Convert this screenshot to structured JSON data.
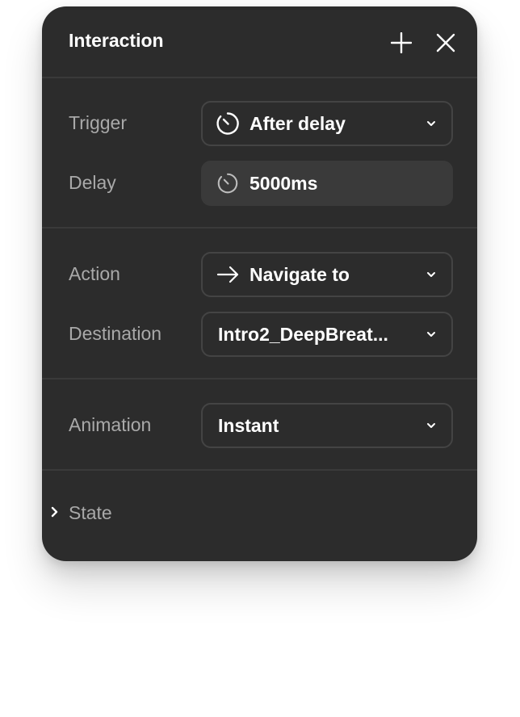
{
  "panel": {
    "title": "Interaction",
    "add_icon": "plus-icon",
    "close_icon": "close-icon"
  },
  "trigger": {
    "label": "Trigger",
    "value": "After delay",
    "icon": "timer-icon"
  },
  "delay": {
    "label": "Delay",
    "value": "5000ms",
    "icon": "timer-icon"
  },
  "action": {
    "label": "Action",
    "value": "Navigate to",
    "icon": "arrow-right-icon"
  },
  "destination": {
    "label": "Destination",
    "value": "Intro2_DeepBreat..."
  },
  "animation": {
    "label": "Animation",
    "value": "Instant"
  },
  "state": {
    "label": "State",
    "icon": "chevron-right-icon"
  },
  "colors": {
    "panel_bg": "#2c2c2c",
    "label_text": "#a9a9a9",
    "value_text": "#ffffff",
    "border": "#444444"
  }
}
